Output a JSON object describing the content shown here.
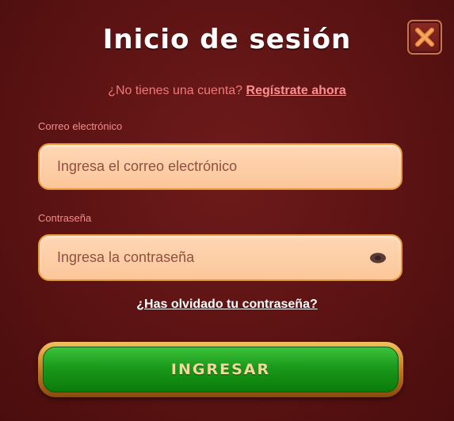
{
  "dialog": {
    "title": "Inicio de sesión"
  },
  "signup": {
    "prompt": "¿No tienes una cuenta?",
    "link": "Regístrate ahora"
  },
  "email": {
    "label": "Correo electrónico",
    "placeholder": "Ingresa el correo electrónico",
    "value": ""
  },
  "password": {
    "label": "Contraseña",
    "placeholder": "Ingresa la contraseña",
    "value": ""
  },
  "forgot": {
    "link": "¿Has olvidado tu contraseña?"
  },
  "submit": {
    "label": "INGRESAR"
  },
  "icons": {
    "close": "close-icon",
    "eye": "eye-icon"
  },
  "colors": {
    "background": "#5a1212",
    "accent": "#f07a7a",
    "field": "#fbc699",
    "button": "#1a9a1a"
  }
}
